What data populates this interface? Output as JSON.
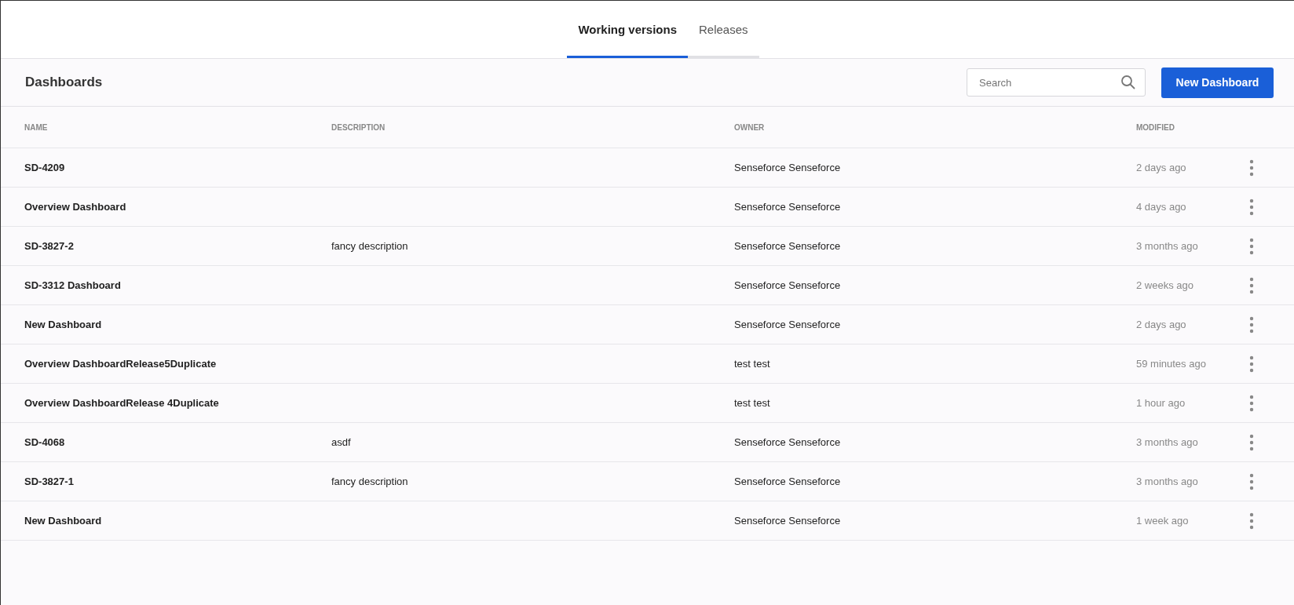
{
  "tabs": [
    {
      "label": "Working versions",
      "selected": true
    },
    {
      "label": "Releases",
      "selected": false
    }
  ],
  "header": {
    "title": "Dashboards",
    "search": {
      "placeholder": "Search"
    },
    "new_button": "New Dashboard"
  },
  "table": {
    "columns": [
      "NAME",
      "DESCRIPTION",
      "OWNER",
      "MODIFIED"
    ],
    "rows": [
      {
        "name": "SD-4209",
        "description": "",
        "owner": "Senseforce Senseforce",
        "modified": "2 days ago"
      },
      {
        "name": "Overview Dashboard",
        "description": "",
        "owner": "Senseforce Senseforce",
        "modified": "4 days ago"
      },
      {
        "name": "SD-3827-2",
        "description": "fancy description",
        "owner": "Senseforce Senseforce",
        "modified": "3 months ago"
      },
      {
        "name": "SD-3312 Dashboard",
        "description": "",
        "owner": "Senseforce Senseforce",
        "modified": "2 weeks ago"
      },
      {
        "name": "New Dashboard",
        "description": "",
        "owner": "Senseforce Senseforce",
        "modified": "2 days ago"
      },
      {
        "name": "Overview DashboardRelease5Duplicate",
        "description": "",
        "owner": "test test",
        "modified": "59 minutes ago"
      },
      {
        "name": "Overview DashboardRelease 4Duplicate",
        "description": "",
        "owner": "test test",
        "modified": "1 hour ago"
      },
      {
        "name": "SD-4068",
        "description": "asdf",
        "owner": "Senseforce Senseforce",
        "modified": "3 months ago"
      },
      {
        "name": "SD-3827-1",
        "description": "fancy description",
        "owner": "Senseforce Senseforce",
        "modified": "3 months ago"
      },
      {
        "name": "New Dashboard",
        "description": "",
        "owner": "Senseforce Senseforce",
        "modified": "1 week ago"
      }
    ]
  }
}
